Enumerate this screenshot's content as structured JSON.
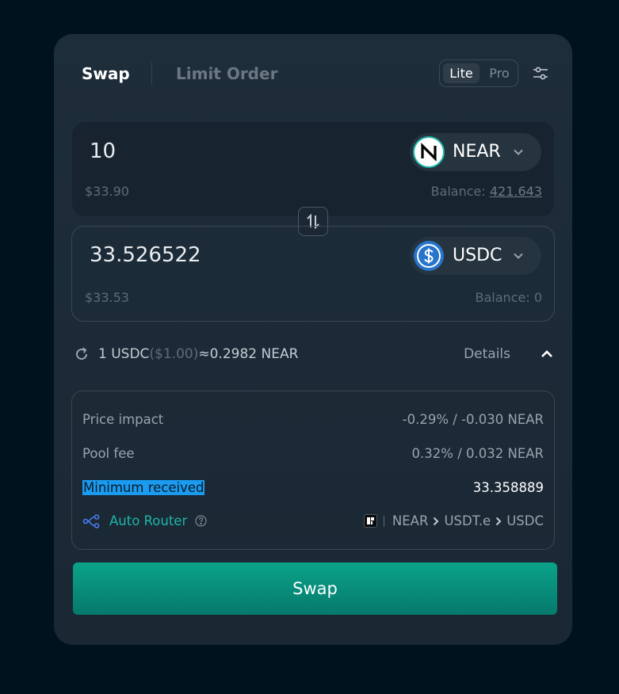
{
  "tabs": {
    "swap": "Swap",
    "limit_order": "Limit Order"
  },
  "mode": {
    "lite": "Lite",
    "pro": "Pro"
  },
  "icons": {
    "settings": "sliders-icon",
    "swap_direction": "swap-arrows-icon",
    "refresh": "refresh-icon",
    "details": "chevron-up-icon",
    "router": "route-nodes-icon",
    "help": "question-circle-icon"
  },
  "from": {
    "amount": "10",
    "token": "NEAR",
    "usd": "$33.90",
    "balance_label": "Balance: ",
    "balance_value": "421.643"
  },
  "to": {
    "amount": "33.526522",
    "token": "USDC",
    "usd": "$33.53",
    "balance_label": "Balance: ",
    "balance_value": "0"
  },
  "rate": {
    "base": "1 USDC",
    "base_usd": "($1.00)",
    "approx": "≈",
    "quote": "0.2982 NEAR",
    "details": "Details"
  },
  "details": {
    "price_impact_label": "Price impact",
    "price_impact_value": "-0.29% / -0.030 NEAR",
    "pool_fee_label": "Pool fee",
    "pool_fee_value": "0.32% / 0.032 NEAR",
    "min_received_label": "Minimum received",
    "min_received_value": "33.358889",
    "router_label": "Auto Router",
    "route": [
      "NEAR",
      "USDT.e",
      "USDC"
    ]
  },
  "colors": {
    "accent": "#0ba389",
    "router": "#1fb5a8",
    "highlight": "#1a9bf0",
    "usdc": "#2775ca"
  },
  "swap_button": "Swap"
}
